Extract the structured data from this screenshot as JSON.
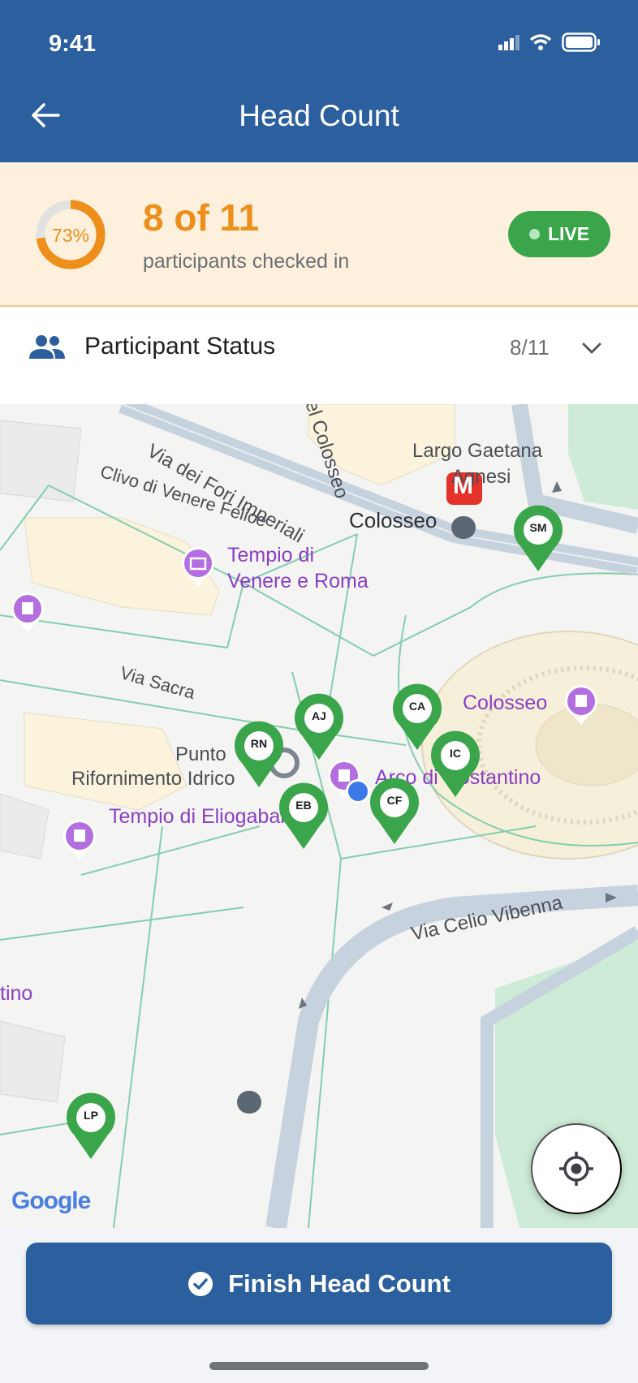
{
  "status_bar": {
    "time": "9:41"
  },
  "header": {
    "title": "Head Count"
  },
  "summary": {
    "percent_label": "73%",
    "percent_value": 0.73,
    "count": "8 of 11",
    "subtitle": "participants checked in",
    "live_label": "LIVE"
  },
  "participant_status": {
    "label": "Participant Status",
    "ratio": "8/11"
  },
  "map": {
    "labels": {
      "via_fori": "Via dei Fori Imperiali",
      "via_colosseo": "el Colosseo",
      "largo_1": "Largo Gaetana",
      "largo_2": "Agnesi",
      "colosseo_station": "Colosseo",
      "metro": "M",
      "clivo": "Clivo di Venere Felice",
      "tempio_venere_1": "Tempio di",
      "tempio_venere_2": "Venere e Roma",
      "via_sacra": "Via Sacra",
      "colosseo_poi": "Colosseo",
      "punto_1": "Punto",
      "punto_2": "Rifornimento Idrico",
      "arco": "Arco di Costantino",
      "tempio_eliogabalo": "Tempio di Eliogabalo",
      "via_celio": "Via Celio Vibenna",
      "tino": "tino",
      "google": "Google"
    },
    "participants": [
      {
        "initials": "SM"
      },
      {
        "initials": "AJ"
      },
      {
        "initials": "CA"
      },
      {
        "initials": "RN"
      },
      {
        "initials": "IC"
      },
      {
        "initials": "CF"
      },
      {
        "initials": "EB"
      },
      {
        "initials": "LP"
      }
    ]
  },
  "footer": {
    "finish_label": "Finish Head Count"
  },
  "colors": {
    "header": "#2c5f9e",
    "accent_orange": "#ee8f1c",
    "live_green": "#3aa54a",
    "pin_green": "#3aa54a",
    "poi_purple": "#8a3fc4"
  }
}
